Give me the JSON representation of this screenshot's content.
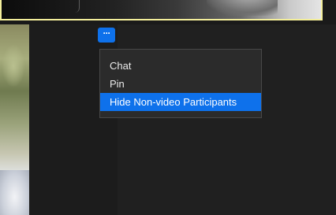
{
  "more_button": {
    "icon": "more-horizontal-icon",
    "label": "···"
  },
  "menu": {
    "items": [
      {
        "label": "Chat",
        "highlighted": false
      },
      {
        "label": "Pin",
        "highlighted": false
      },
      {
        "label": "Hide Non-video Participants",
        "highlighted": true
      }
    ]
  },
  "colors": {
    "accent": "#0e71eb",
    "active_speaker_border": "#f4ef9c",
    "menu_background": "#2b2b2b"
  }
}
